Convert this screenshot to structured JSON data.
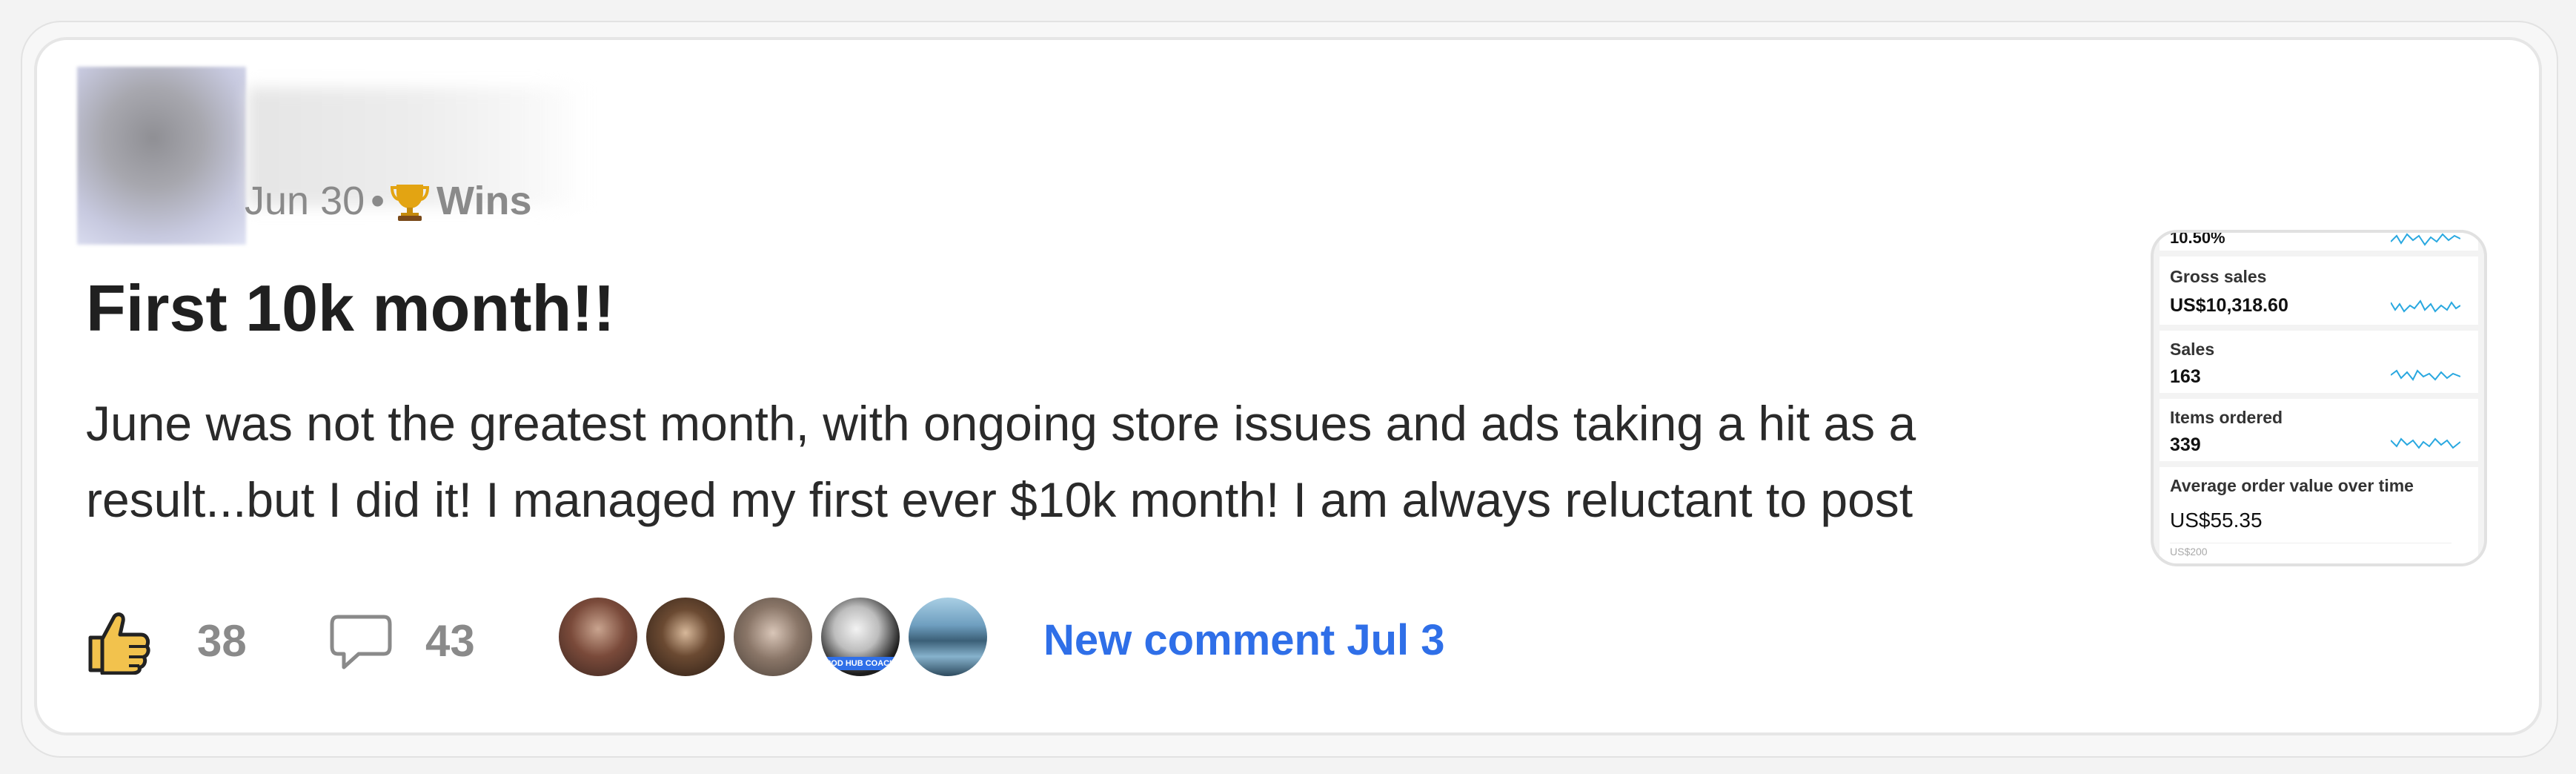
{
  "post": {
    "date": "Jun 30",
    "separator": "•",
    "category": "Wins",
    "title": "First 10k month!!",
    "body_lines": [
      "June was not the greatest month, with ongoing store issues and ads taking a hit as a",
      "result...but I did it! I managed my first ever $10k month! I am always reluctant to post"
    ]
  },
  "thumbnail": {
    "top_value": "10.50%",
    "rows": [
      {
        "label": "Gross sales",
        "value": "US$10,318.60"
      },
      {
        "label": "Sales",
        "value": "163"
      },
      {
        "label": "Items ordered",
        "value": "339"
      },
      {
        "label": "Average order value over time",
        "value": "US$55.35"
      }
    ],
    "axis_label": "US$200"
  },
  "stats": {
    "likes": "38",
    "comments": "43",
    "new_comment": "New comment Jul 3"
  },
  "avatar_badge": "POD HUB COACH",
  "colors": {
    "accent": "#2f6fe8",
    "muted": "#8a8a8a",
    "title": "#202020",
    "spark": "#29a8e0",
    "trophy": "#e3a412"
  },
  "icons": {
    "like": "thumbs-up-icon",
    "comment": "speech-bubble-icon",
    "category": "trophy-icon"
  }
}
